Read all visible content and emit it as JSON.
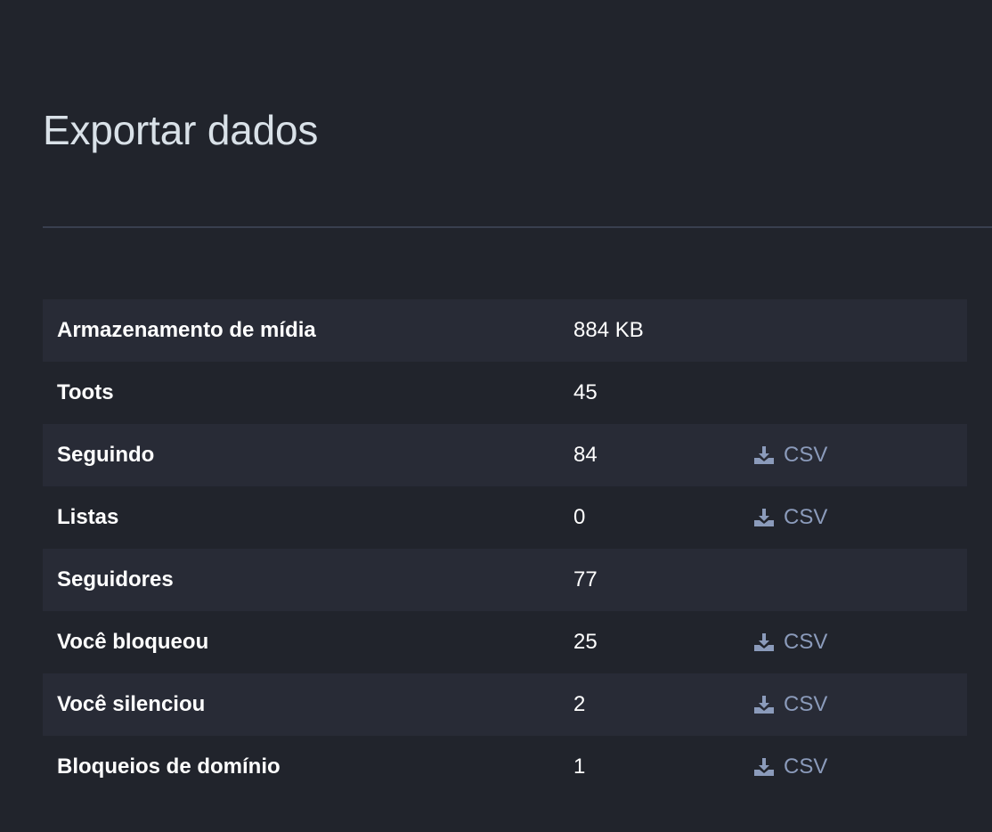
{
  "header": {
    "title": "Exportar dados"
  },
  "colors": {
    "background": "#21242c",
    "row_stripe": "#282b36",
    "title_text": "#d9e1e8",
    "link_text": "#8b9bbb",
    "divider": "#393f4f"
  },
  "export_table": {
    "rows": [
      {
        "label": "Armazenamento de mídia",
        "value": "884 KB",
        "action": ""
      },
      {
        "label": "Toots",
        "value": "45",
        "action": ""
      },
      {
        "label": "Seguindo",
        "value": "84",
        "action": "CSV",
        "icon": "download-icon"
      },
      {
        "label": "Listas",
        "value": "0",
        "action": "CSV",
        "icon": "download-icon"
      },
      {
        "label": "Seguidores",
        "value": "77",
        "action": ""
      },
      {
        "label": "Você bloqueou",
        "value": "25",
        "action": "CSV",
        "icon": "download-icon"
      },
      {
        "label": "Você silenciou",
        "value": "2",
        "action": "CSV",
        "icon": "download-icon"
      },
      {
        "label": "Bloqueios de domínio",
        "value": "1",
        "action": "CSV",
        "icon": "download-icon"
      }
    ]
  }
}
